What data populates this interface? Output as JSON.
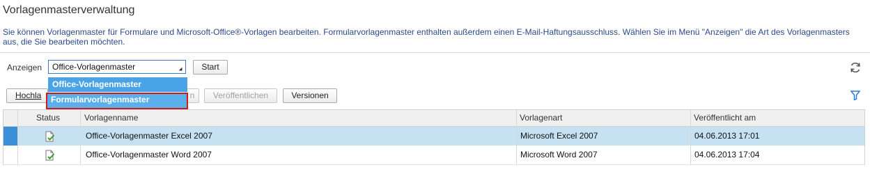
{
  "page": {
    "title": "Vorlagenmasterverwaltung",
    "description": "Sie können Vorlagenmaster für Formulare und Microsoft-Office®-Vorlagen bearbeiten. Formularvorlagenmaster enthalten außerdem einen E-Mail-Haftungsausschluss. Wählen Sie im Menü \"Anzeigen\" die Art des Vorlagenmasters aus, die Sie bearbeiten möchten."
  },
  "filter": {
    "label": "Anzeigen",
    "selected": "Office-Vorlagenmaster",
    "options": [
      "Office-Vorlagenmaster",
      "Formularvorlagenmaster"
    ],
    "start_label": "Start"
  },
  "toolbar": {
    "upload_label": "Hochla",
    "hidden_label": "n",
    "publish_label": "Veröffentlichen",
    "versions_label": "Versionen"
  },
  "table": {
    "headers": [
      "Status",
      "Vorlagenname",
      "Vorlagenart",
      "Veröffentlicht am"
    ],
    "rows": [
      {
        "name": "Office-Vorlagenmaster Excel 2007",
        "type": "Microsoft Excel 2007",
        "date": "04.06.2013 17:01",
        "selected": true
      },
      {
        "name": "Office-Vorlagenmaster Word 2007",
        "type": "Microsoft Word 2007",
        "date": "04.06.2013 17:04",
        "selected": false
      }
    ]
  },
  "icons": {
    "refresh": "refresh-icon",
    "filter": "funnel-icon",
    "status": "published-document-icon"
  },
  "colors": {
    "accent": "#3a78c9",
    "selected_row": "#c6e1f2",
    "highlight_border": "#d11a1a"
  }
}
